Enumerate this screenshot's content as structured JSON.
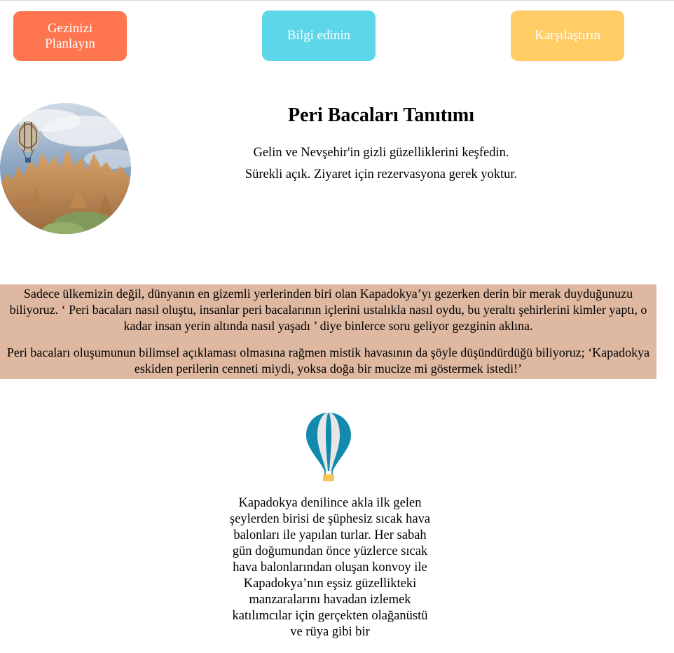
{
  "nav": {
    "plan_label": "Gezinizi Planlayın",
    "info_label": "Bilgi edinin",
    "compare_label": "Karşılaştırın",
    "colors": {
      "plan": "#ff7550",
      "info": "#5ed6ea",
      "compare": "#ffcc66"
    }
  },
  "hero": {
    "image_icon": "fairy-chimneys-balloon-photo",
    "title": "Peri Bacaları Tanıtımı",
    "line1": "Gelin ve Nevşehir'in gizli güzelliklerini keşfedin.",
    "line2": "Sürekli açık. Ziyaret için rezervasyona gerek yoktur."
  },
  "intro": {
    "background": "#deb8a0",
    "paragraph1": "Sadece ülkemizin değil, dünyanın en gizemli yerlerinden biri olan Kapadokya’yı gezerken derin bir merak duyduğunuzu biliyoruz. ‘ Peri bacaları nasıl oluştu, insanlar peri bacalarının içlerini ustalıkla nasıl oydu, bu yeraltı şehirlerini kimler yaptı, o kadar insan yerin altında nasıl yaşadı ’ diye binlerce soru geliyor gezginin aklına.",
    "paragraph2": "Peri bacaları oluşumunun bilimsel açıklaması olmasına rağmen mistik havasının da şöyle düşündürdüğü biliyoruz; ‘Kapadokya eskiden perilerin cenneti miydi, yoksa doğa bir mucize mi göstermek istedi!’"
  },
  "balloon_section": {
    "icon": "hot-air-balloon-icon",
    "text": "Kapadokya denilince akla ilk gelen şeylerden birisi de şüphesiz sıcak hava balonları ile yapılan turlar. Her sabah gün doğumundan önce yüzlerce sıcak hava balonlarından oluşan konvoy ile Kapadokya’nın eşsiz güzellikteki manzaralarını havadan izlemek katılımcılar için gerçekten olağanüstü ve rüya gibi bir"
  }
}
